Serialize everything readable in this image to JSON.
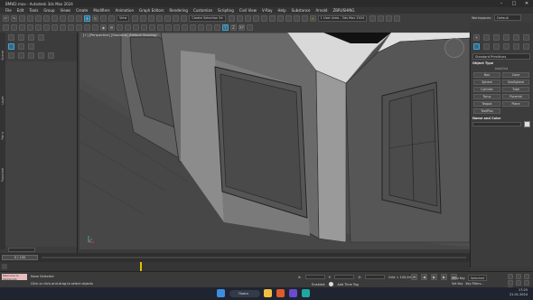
{
  "window": {
    "title": "BMW2.max - Autodesk 3ds Max 2024"
  },
  "menu": [
    "File",
    "Edit",
    "Tools",
    "Group",
    "Views",
    "Create",
    "Modifiers",
    "Animation",
    "Graph Editors",
    "Rendering",
    "Customize",
    "Scripting",
    "Civil View",
    "V-Ray",
    "Help",
    "Substance",
    "Arnold",
    "ZBRUSHING"
  ],
  "toolbar": {
    "view_dropdown": "View",
    "selection_set": "Create Selection Se",
    "workspace_left": "Workspaces:",
    "workspace_value": "Default",
    "user_area": "1 User Area - 3ds Max 2024"
  },
  "viewport": {
    "label": "[+] [Perspective] [Standard] [Default Shading]"
  },
  "command_panel": {
    "category": "Standard Primitives",
    "object_type_header": "Object Type",
    "autogrid": "AutoGrid",
    "primitives": [
      "Box",
      "Cone",
      "Sphere",
      "GeoSphere",
      "Cylinder",
      "Tube",
      "Torus",
      "Pyramid",
      "Teapot",
      "Plane",
      "TextPlus"
    ],
    "name_color_header": "Name and Color"
  },
  "timeline": {
    "frame_display": "0 / 100"
  },
  "status": {
    "selection": "None Selected",
    "prompt": "Click or click-and-drag to select objects",
    "welcome": "Welcome to MAXScript.",
    "x_label": "X:",
    "y_label": "Y:",
    "z_label": "Z:",
    "grid": "Grid = 100,0mm",
    "enabled": "Enabled:",
    "add_time_tag": "Add Time Tag",
    "auto_key": "Auto Key",
    "selected": "Selected",
    "set_key": "Set Key",
    "key_filters": "Key Filters..."
  },
  "taskbar": {
    "search": "Поиск",
    "time": "17:25",
    "date": "21.01.2024"
  },
  "colors": {
    "accent": "#2f6b8c",
    "viewport_bg": "#4e4e4e",
    "taskbar_bg": "#1f2430"
  }
}
